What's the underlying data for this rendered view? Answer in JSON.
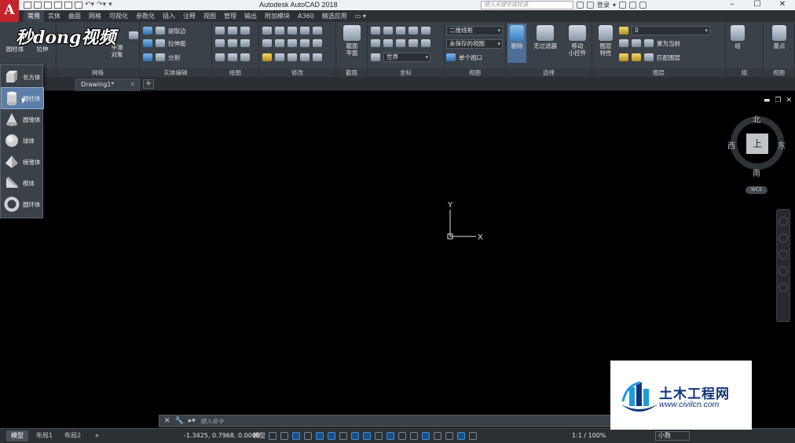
{
  "window": {
    "app_logo": "A",
    "title": "Autodesk AutoCAD 2018",
    "search_placeholder": "键入关键字或短语",
    "login": "登录",
    "controls": [
      "–",
      "☐",
      "✕"
    ]
  },
  "ribbon_tabs": [
    "常用",
    "实体",
    "曲面",
    "网格",
    "可视化",
    "参数化",
    "插入",
    "注释",
    "视图",
    "管理",
    "输出",
    "附加模块",
    "A360",
    "精选应用",
    "▭ ▾"
  ],
  "ribbon": {
    "cylinder_label": "圆柱体",
    "extrude_label": "拉伸",
    "smooth_label": "平滑",
    "object_label": "对象",
    "extract_edges": "提取边",
    "extrude_face": "拉伸面",
    "split": "分割",
    "section_plane_1": "截面",
    "section_plane_2": "平面",
    "visual_style": "二维线框",
    "saved_view": "未保存的视图",
    "world": "世界",
    "single_viewport": "单个视口",
    "cull": "剔除",
    "no_filter": "无过滤器",
    "move_1": "移动",
    "move_2": "小控件",
    "layer_prop_1": "图层",
    "layer_prop_2": "特性",
    "layer_current": "置为当前",
    "layer_match": "匹配图层",
    "layer_value": "0",
    "group": "组",
    "base_point": "基点",
    "panels": [
      "建模",
      "网格",
      "实体编辑",
      "绘图",
      "修改",
      "截面",
      "坐标",
      "视图",
      "选择",
      "图层",
      "组",
      "视图"
    ]
  },
  "brand_watermark": "秒dong视频",
  "doc_tab": "Drawing1*",
  "dropdown_items": [
    "长方体",
    "圆柱体",
    "圆锥体",
    "球体",
    "棱锥体",
    "楔体",
    "圆环体"
  ],
  "viewcube": {
    "north": "北",
    "south": "南",
    "east": "东",
    "west": "西",
    "face": "上",
    "wcs": "WCS"
  },
  "ucs": {
    "y_label": "Y",
    "x_label": "X"
  },
  "command": {
    "placeholder": "键入命令"
  },
  "status": {
    "layout_tabs": [
      "模型",
      "布局1",
      "布局2"
    ],
    "coords": "-1.3425, 0.7968, 0.0000",
    "model": "模型",
    "scale": "1:1 / 100%",
    "units": "小数"
  },
  "logo": {
    "cn": "土木工程网",
    "en": "www.civilcn.com"
  }
}
